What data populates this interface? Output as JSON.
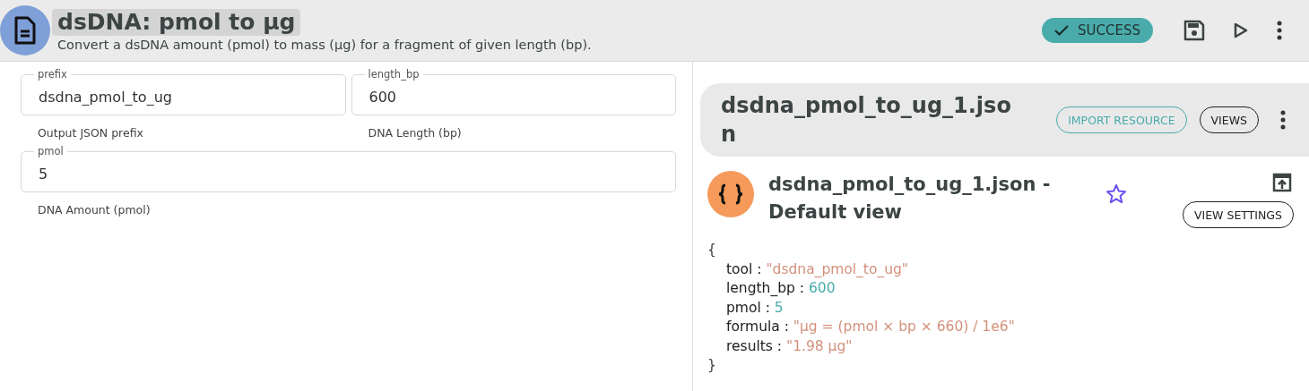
{
  "header": {
    "title": "dsDNA: pmol to µg",
    "description": "Convert a dsDNA amount (pmol) to mass (µg) for a fragment of given length (bp).",
    "status": {
      "label": "SUCCESS",
      "kind": "success"
    }
  },
  "form": {
    "rows": [
      {
        "fields": [
          {
            "label": "prefix",
            "value": "dsdna_pmol_to_ug",
            "helper": "Output JSON prefix"
          },
          {
            "label": "length_bp",
            "value": "600",
            "helper": "DNA Length (bp)"
          }
        ]
      },
      {
        "fields": [
          {
            "label": "pmol",
            "value": "5",
            "helper": "DNA Amount (pmol)"
          }
        ]
      }
    ]
  },
  "resource": {
    "title": "dsdna_pmol_to_ug_1.json",
    "buttons": [
      {
        "label": "IMPORT RESOURCE",
        "kind": "accent"
      },
      {
        "label": "VIEWS",
        "kind": "outline"
      }
    ],
    "view": {
      "title": "dsdna_pmol_to_ug_1.json - Default view",
      "starred": false,
      "settings_button": "VIEW SETTINGS",
      "open_brace": "{",
      "close_brace": "}",
      "entries": [
        {
          "key": "tool :",
          "value": "\"dsdna_pmol_to_ug\"",
          "color": "#d3917c"
        },
        {
          "key": "length_bp :",
          "value": "600",
          "color": "#4aabab"
        },
        {
          "key": "pmol :",
          "value": "5",
          "color": "#4aabab"
        },
        {
          "key": "formula :",
          "value": "\"µg = (pmol × bp × 660) / 1e6\"",
          "color": "#d3917c"
        },
        {
          "key": "results :",
          "value": "\"1.98 µg\"",
          "color": "#d3917c"
        }
      ]
    }
  }
}
